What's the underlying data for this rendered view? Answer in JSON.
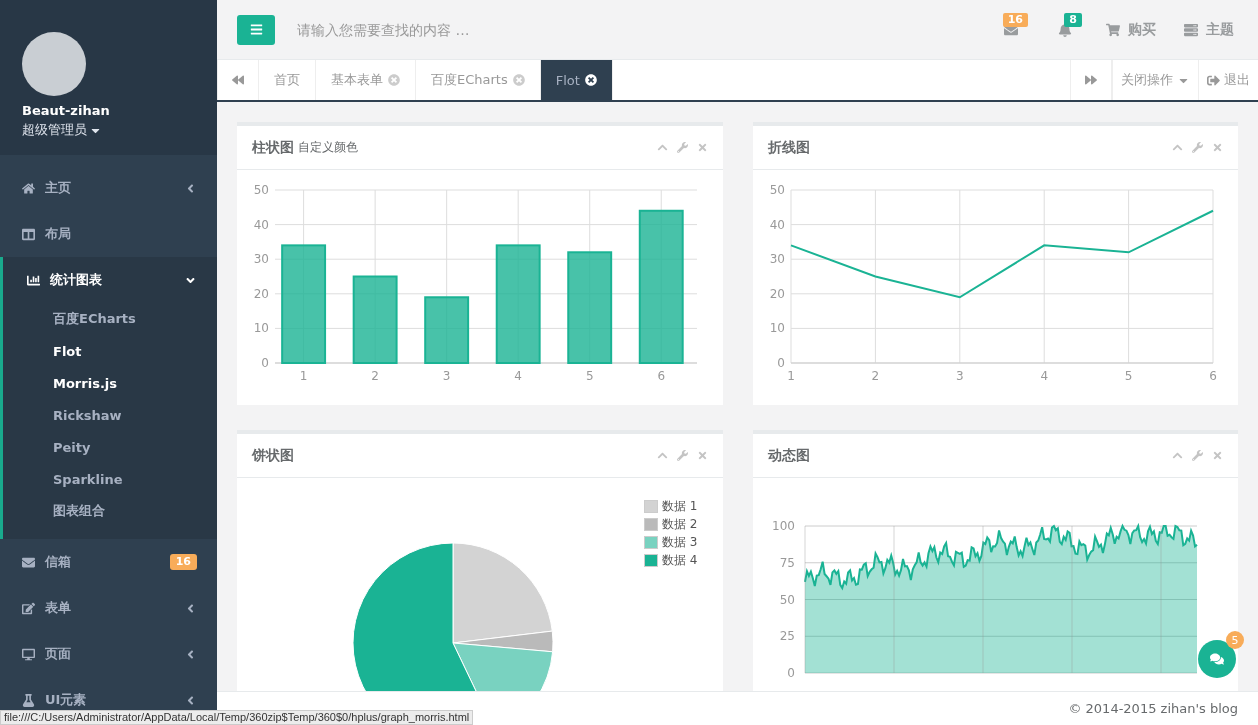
{
  "sidebar": {
    "profile": {
      "name": "Beaut-zihan",
      "role": "超级管理员"
    },
    "items": [
      {
        "label": "主页",
        "collapsible": true,
        "expanded": false
      },
      {
        "label": "布局",
        "collapsible": false,
        "expanded": false
      },
      {
        "label": "统计图表",
        "collapsible": true,
        "expanded": true,
        "children": [
          {
            "label": "百度ECharts",
            "highlighted": false
          },
          {
            "label": "Flot",
            "highlighted": true
          },
          {
            "label": "Morris.js",
            "highlighted": true
          },
          {
            "label": "Rickshaw",
            "highlighted": false
          },
          {
            "label": "Peity",
            "highlighted": false
          },
          {
            "label": "Sparkline",
            "highlighted": false
          },
          {
            "label": "图表组合",
            "highlighted": false
          }
        ]
      },
      {
        "label": "信箱",
        "badge": "16",
        "collapsible": false,
        "expanded": false
      },
      {
        "label": "表单",
        "collapsible": true,
        "expanded": false
      },
      {
        "label": "页面",
        "collapsible": true,
        "expanded": false
      },
      {
        "label": "UI元素",
        "collapsible": true,
        "expanded": false
      }
    ]
  },
  "topbar": {
    "search": {
      "placeholder": "请输入您需要查找的内容 …"
    },
    "mail_badge": "16",
    "bell_badge": "8",
    "buy": "购买",
    "theme": "主题"
  },
  "tabs": [
    {
      "label": "首页",
      "closable": false,
      "selected": false
    },
    {
      "label": "基本表单",
      "closable": true,
      "selected": false
    },
    {
      "label": "百度ECharts",
      "closable": true,
      "selected": false
    },
    {
      "label": "Flot",
      "closable": true,
      "selected": true
    }
  ],
  "tab_actions": {
    "close_ops": "关闭操作",
    "logout": "退出"
  },
  "panels": [
    {
      "kind": "chart",
      "title": "柱状图",
      "subtitle": "自定义颜色",
      "chart_data": {
        "type": "bar",
        "x": [
          1,
          2,
          3,
          4,
          5,
          6
        ],
        "series": [
          {
            "color": "#1ab394",
            "values": [
              34,
              25,
              19,
              34,
              32,
              44
            ]
          }
        ],
        "xlim": [
          0.6,
          6.5
        ],
        "ylim": [
          0,
          50
        ],
        "xticks": [
          1,
          2,
          3,
          4,
          5,
          6
        ],
        "yticks": [
          0,
          10,
          20,
          30,
          40,
          50
        ],
        "grid": true
      }
    },
    {
      "kind": "chart",
      "title": "折线图",
      "chart_data": {
        "type": "line",
        "x": [
          1,
          2,
          3,
          4,
          5,
          6
        ],
        "series": [
          {
            "color": "#1ab394",
            "values": [
              34,
              25,
              19,
              34,
              32,
              44
            ]
          }
        ],
        "xlim": [
          1,
          6
        ],
        "ylim": [
          0,
          50
        ],
        "xticks": [
          1,
          2,
          3,
          4,
          5,
          6
        ],
        "yticks": [
          0,
          10,
          20,
          30,
          40,
          50
        ],
        "grid": true
      }
    },
    {
      "kind": "chart",
      "title": "饼状图",
      "chart_data": {
        "type": "pie",
        "categories": [
          "数据 1",
          "数据 2",
          "数据 3",
          "数据 4"
        ],
        "series": [
          {
            "values": [
              23.1,
              3.3,
              16.5,
              57.1
            ]
          }
        ],
        "colors": [
          "#d3d3d3",
          "#bababa",
          "#79d2c0",
          "#1ab394"
        ],
        "legend": true
      }
    },
    {
      "kind": "realtime",
      "title": "动态图",
      "y_labels": [
        "100",
        "75",
        "50",
        "25",
        "0"
      ]
    }
  ],
  "footer": {
    "copyright": "© 2014-2015 zihan's blog"
  },
  "chat_badge": "5",
  "status_url": "file:///C:/Users/Administrator/AppData/Local/Temp/360zip$Temp/360$0/hplus/graph_morris.html"
}
